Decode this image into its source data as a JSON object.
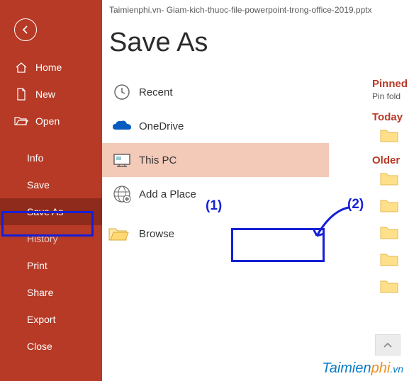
{
  "titlebar": "Taimienphi.vn- Giam-kich-thuoc-file-powerpoint-trong-office-2019.pptx",
  "heading": "Save As",
  "sidebar": {
    "home": "Home",
    "new": "New",
    "open": "Open",
    "info": "Info",
    "save": "Save",
    "saveas": "Save As",
    "history": "History",
    "print": "Print",
    "share": "Share",
    "export": "Export",
    "close": "Close"
  },
  "locations": {
    "recent": "Recent",
    "onedrive": "OneDrive",
    "thispc": "This PC",
    "addplace": "Add a Place",
    "browse": "Browse"
  },
  "right": {
    "pinned": "Pinned",
    "pinnedSub": "Pin fold",
    "today": "Today",
    "older": "Older"
  },
  "annotations": {
    "one": "(1)",
    "two": "(2)"
  },
  "watermark": {
    "a": "Taimien",
    "b": "phi",
    "c": ".vn"
  }
}
